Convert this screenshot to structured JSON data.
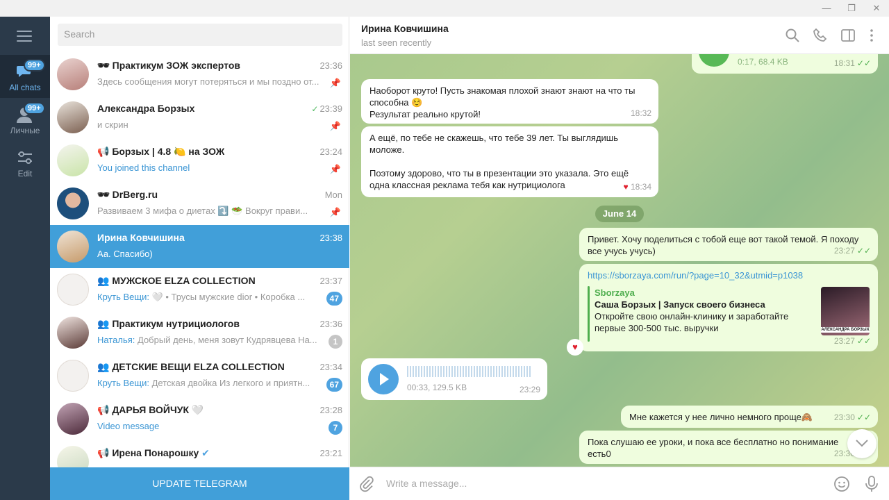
{
  "window": {
    "minimize": "—",
    "maximize": "❐",
    "close": "✕"
  },
  "rail": {
    "folders": [
      {
        "label": "All chats",
        "badge": "99+"
      },
      {
        "label": "Личные",
        "badge": "99+"
      },
      {
        "label": "Edit"
      }
    ]
  },
  "search": {
    "placeholder": "Search"
  },
  "chats": [
    {
      "name": "🕶 Практикум ЗОЖ экспертов",
      "time": "23:36",
      "msg": "Здесь сообщения могут потеряться и мы поздно от...",
      "pinned": true
    },
    {
      "name": "Александра Борзых",
      "time": "23:39",
      "msg": "и скрин",
      "pinned": true,
      "read": "✓"
    },
    {
      "name": "📢 Борзых | 4.8 🍋 на ЗОЖ",
      "time": "23:24",
      "msg": "You joined this channel",
      "pinned": true
    },
    {
      "name": "🕶 DrBerg.ru",
      "time": "Mon",
      "msg": "Развиваем 3 мифа о диетах ⤵️  🥗 Вокруг прави...",
      "pinned": true
    },
    {
      "name": "Ирина Ковчишина",
      "time": "23:38",
      "msg": "Аа.  Спасибо)"
    },
    {
      "name": "👥 МУЖСКОЕ ELZA COLLECTION",
      "time": "23:37",
      "sender": "Круть Вещи:",
      "msg": " 🤍 • Трусы мужские dior  • Коробка ...",
      "count": "47"
    },
    {
      "name": "👥 Практикум нутрициологов",
      "time": "23:36",
      "sender": "Наталья:",
      "msg": " Добрый день, меня зовут Кудрявцева На...",
      "count": "1"
    },
    {
      "name": "👥 ДЕТСКИЕ ВЕЩИ ELZA COLLECTION",
      "time": "23:34",
      "sender": "Круть Вещи:",
      "msg": " Детская  двойка  Из легкого и приятн...",
      "count": "67"
    },
    {
      "name": "📢 ДАРЬЯ ВОЙЧУК 🤍",
      "time": "23:28",
      "sender": "",
      "msg": "Video message",
      "count": "7"
    },
    {
      "name": "📢 Ирена Понарошку",
      "time": "23:21",
      "msg": "",
      "verified": "✔"
    }
  ],
  "update_button": "UPDATE TELEGRAM",
  "chat": {
    "name": "Ирина Ковчишина",
    "status": "last seen recently",
    "top_voice": {
      "meta": "0:17, 68.4 KB",
      "time": "18:31"
    },
    "m1": {
      "l1": "Наоборот круто! Пусть знакомая плохой знают знают на что ты",
      "l2": "способна ☺️",
      "l3": "Результат реально крутой!",
      "time": "18:32"
    },
    "m2": {
      "l1": "А ещё, по тебе не скажешь, что тебе 39 лет. Ты выглядишь",
      "l2": "моложе.",
      "l3": "Поэтому здорово, что ты в презентации это указала. Это ещё",
      "l4": "одна классная реклама тебя как нутрициолога",
      "time": "18:34",
      "reaction": "♥"
    },
    "date": "June 14",
    "m3": {
      "l1": "Привет. Хочу поделиться с тобой еще вот такой темой. Я походу",
      "l2": "все учусь учусь)",
      "time": "23:27"
    },
    "m4": {
      "url": "https://sborzaya.com/run/?page=10_32&utmid=p1038",
      "site": "Sborzaya",
      "title": "Саша Борзых | Запуск своего бизнеса",
      "d1": "Откройте свою онлайн-клинику и заработайте",
      "d2": "первые 300-500 тыс. выручки",
      "time": "23:27",
      "thumb": "АЛЕКСАНДРА БОРЗЫХ",
      "reaction": "♥"
    },
    "m5": {
      "meta": "00:33, 129.5 KB",
      "time": "23:29"
    },
    "m6": {
      "text": "Мне кажется у нее лично немного проще🙈",
      "time": "23:30"
    },
    "m7": {
      "l1": "Пока слушаю ее уроки, и пока все бесплатно  но понимание",
      "l2": "есть0",
      "time": "23:30"
    },
    "ticks": "✓✓"
  },
  "composer": {
    "placeholder": "Write a message..."
  }
}
